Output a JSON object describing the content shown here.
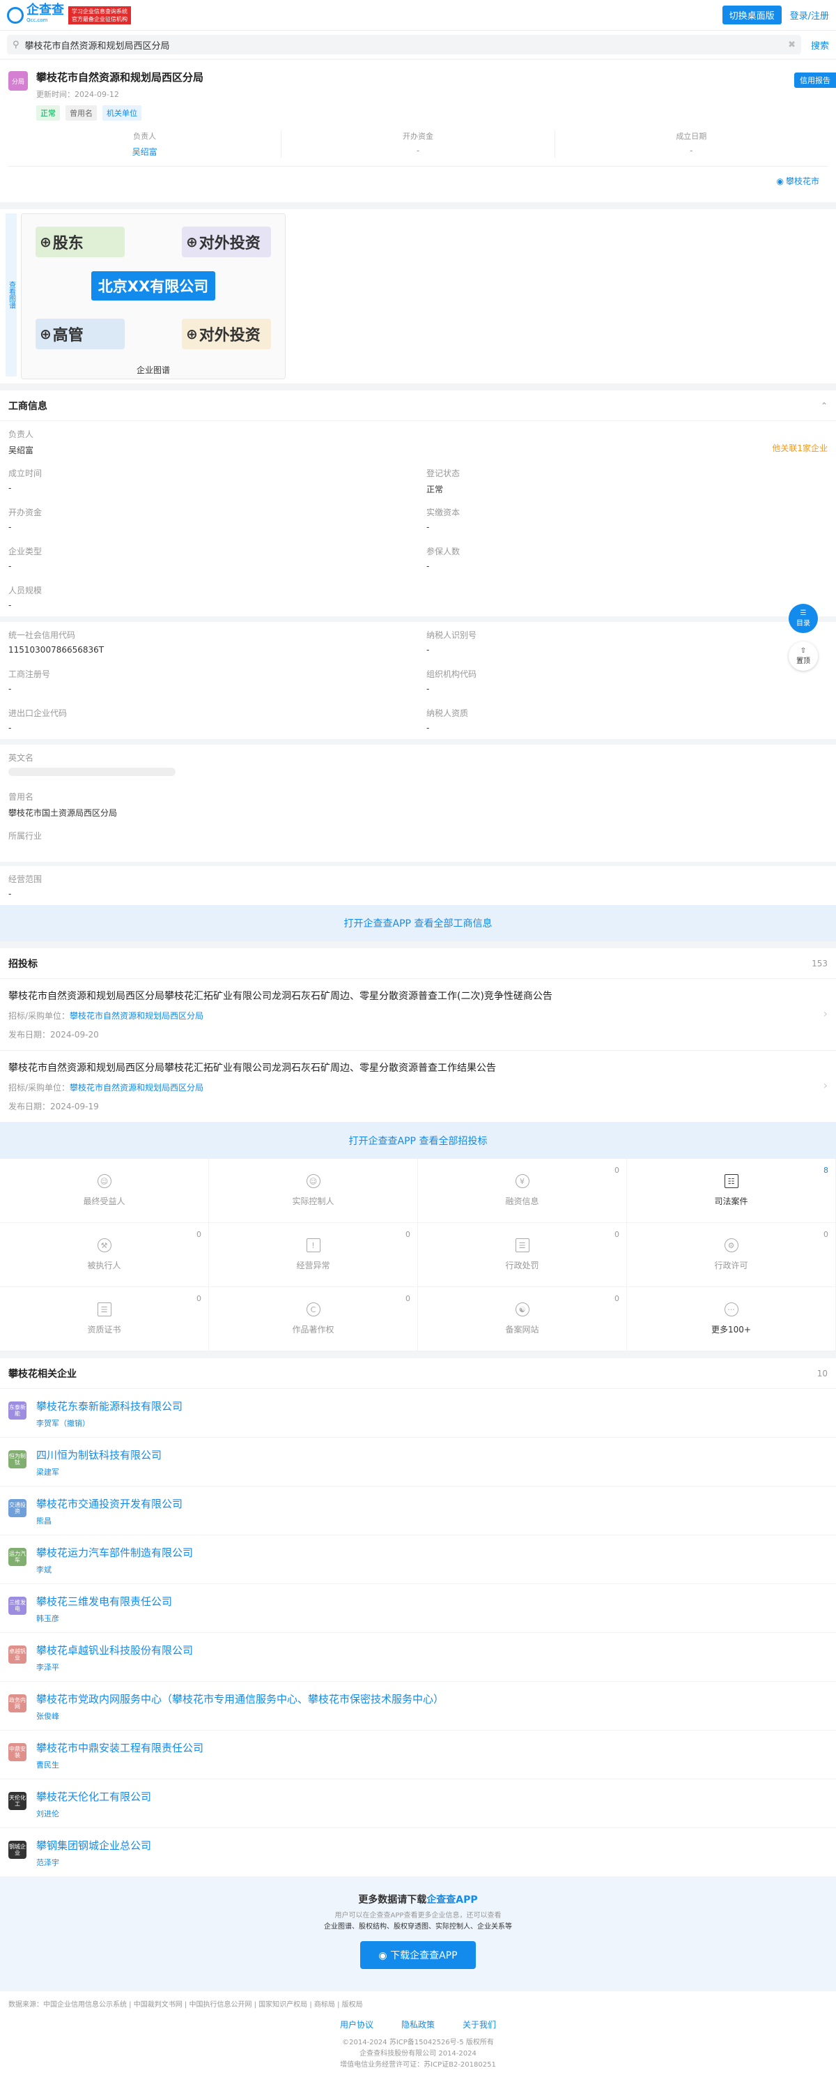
{
  "topbar": {
    "logo": "企查查",
    "logo_sub": "Qcc.com",
    "badge": "学习企业信息查询系统 官方最备企业征信机构",
    "desk_btn": "切换桌面版",
    "login": "登录/注册"
  },
  "search": {
    "value": "攀枝花市自然资源和规划局西区分局",
    "btn": "搜索"
  },
  "company": {
    "avatar": "分局",
    "name": "攀枝花市自然资源和规划局西区分局",
    "updated": "更新时间：2024-09-12",
    "tags": [
      "正常",
      "曾用名",
      "机关单位"
    ],
    "credit_btn": "信用报告",
    "kv": [
      {
        "k": "负责人",
        "v": "吴绍富"
      },
      {
        "k": "开办资金",
        "v": "-"
      },
      {
        "k": "成立日期",
        "v": "-"
      }
    ],
    "location": "攀枝花市"
  },
  "graph": {
    "tab": "查看图谱",
    "shareholder": "股东",
    "invest1": "对外投资",
    "center": "北京XX有限公司",
    "exec": "高管",
    "invest2": "对外投资",
    "caption": "企业图谱"
  },
  "biz": {
    "title": "工商信息",
    "head_k": "负责人",
    "head_v": "吴绍富",
    "head_link": "他关联1家企业",
    "rows": [
      {
        "k": "成立时间",
        "v": "-"
      },
      {
        "k": "登记状态",
        "v": "正常"
      },
      {
        "k": "开办资金",
        "v": "-"
      },
      {
        "k": "实缴资本",
        "v": "-"
      },
      {
        "k": "企业类型",
        "v": "-"
      },
      {
        "k": "参保人数",
        "v": "-"
      },
      {
        "k": "人员规模",
        "v": "-"
      }
    ],
    "rows2": [
      {
        "k": "统一社会信用代码",
        "v": "11510300786656836T"
      },
      {
        "k": "纳税人识别号",
        "v": "-"
      },
      {
        "k": "工商注册号",
        "v": "-"
      },
      {
        "k": "组织机构代码",
        "v": "-"
      },
      {
        "k": "进出口企业代码",
        "v": "-"
      },
      {
        "k": "纳税人资质",
        "v": "-"
      }
    ],
    "en_k": "英文名",
    "used_k": "曾用名",
    "used_v": "攀枝花市国土资源局西区分局",
    "industry_k": "所属行业",
    "scope_k": "经营范围",
    "scope_v": "-",
    "open": "打开企查查APP 查看全部工商信息"
  },
  "bids": {
    "title": "招投标",
    "count": "153",
    "open": "打开企查查APP 查看全部招投标",
    "items": [
      {
        "title": "攀枝花市自然资源和规划局西区分局攀枝花汇拓矿业有限公司龙洞石灰石矿周边、零星分散资源普查工作(二次)竞争性磋商公告",
        "buyer_k": "招标/采购单位：",
        "buyer": "攀枝花市自然资源和规划局西区分局",
        "date": "发布日期：2024-09-20"
      },
      {
        "title": "攀枝花市自然资源和规划局西区分局攀枝花汇拓矿业有限公司龙洞石灰石矿周边、零星分散资源普查工作结果公告",
        "buyer_k": "招标/采购单位：",
        "buyer": "攀枝花市自然资源和规划局西区分局",
        "date": "发布日期：2024-09-19"
      }
    ]
  },
  "grid": [
    {
      "l": "最终受益人",
      "n": ""
    },
    {
      "l": "实际控制人",
      "n": ""
    },
    {
      "l": "融资信息",
      "n": "0"
    },
    {
      "l": "司法案件",
      "n": "8"
    },
    {
      "l": "被执行人",
      "n": "0"
    },
    {
      "l": "经营异常",
      "n": "0"
    },
    {
      "l": "行政处罚",
      "n": "0"
    },
    {
      "l": "行政许可",
      "n": "0"
    },
    {
      "l": "资质证书",
      "n": "0"
    },
    {
      "l": "作品著作权",
      "n": "0"
    },
    {
      "l": "备案网站",
      "n": "0"
    },
    {
      "l": "更多100+",
      "n": ""
    }
  ],
  "related": {
    "title": "攀枝花相关企业",
    "count": "10",
    "items": [
      {
        "logo": "东泰新能",
        "color": "#9c8de0",
        "name": "攀枝花东泰新能源科技有限公司",
        "person": "李贺军（撤销）"
      },
      {
        "logo": "恒为制钛",
        "color": "#7fae6f",
        "name": "四川恒为制钛科技有限公司",
        "person": "梁建军"
      },
      {
        "logo": "交通投资",
        "color": "#6f9fd8",
        "name": "攀枝花市交通投资开发有限公司",
        "person": "熊昌"
      },
      {
        "logo": "运力汽车",
        "color": "#7fae6f",
        "name": "攀枝花运力汽车部件制造有限公司",
        "person": "李斌"
      },
      {
        "logo": "三维发电",
        "color": "#9c8de0",
        "name": "攀枝花三维发电有限责任公司",
        "person": "韩玉彦"
      },
      {
        "logo": "卓越钒业",
        "color": "#e0908a",
        "name": "攀枝花卓越钒业科技股份有限公司",
        "person": "李泽平"
      },
      {
        "logo": "政务内网",
        "color": "#e0908a",
        "name": "攀枝花市党政内网服务中心（攀枝花市专用通信服务中心、攀枝花市保密技术服务中心）",
        "person": "张俊峰"
      },
      {
        "logo": "中鼎安装",
        "color": "#e0908a",
        "name": "攀枝花市中鼎安装工程有限责任公司",
        "person": "曹民生"
      },
      {
        "logo": "天伦化工",
        "color": "#333333",
        "name": "攀枝花天伦化工有限公司",
        "person": "刘进伦"
      },
      {
        "logo": "钢城企业",
        "color": "#333333",
        "name": "攀钢集团钢城企业总公司",
        "person": "范泽宇"
      }
    ]
  },
  "promo": {
    "title": "更多数据请下载",
    "app": "企查查APP",
    "desc1": "用户可以在企查查APP查看更多企业信息，还可以查看",
    "desc2": "企业图谱、股权结构、股权穿透图、实际控制人、企业关系等",
    "btn": "下载企查查APP"
  },
  "footer": {
    "source": "数据来源：中国企业信用信息公示系统 | 中国裁判文书网 | 中国执行信息公开网 | 国家知识产权局 | 商标局 | 版权局",
    "links": [
      "用户协议",
      "隐私政策",
      "关于我们"
    ],
    "c1": "©2014-2024 苏ICP备15042526号-5 版权所有",
    "c2": "企查查科技股份有限公司 2014-2024",
    "c3": "增值电信业务经营许可证：苏ICP证B2-20180251"
  },
  "float": {
    "menu": "目录",
    "top": "置顶"
  }
}
